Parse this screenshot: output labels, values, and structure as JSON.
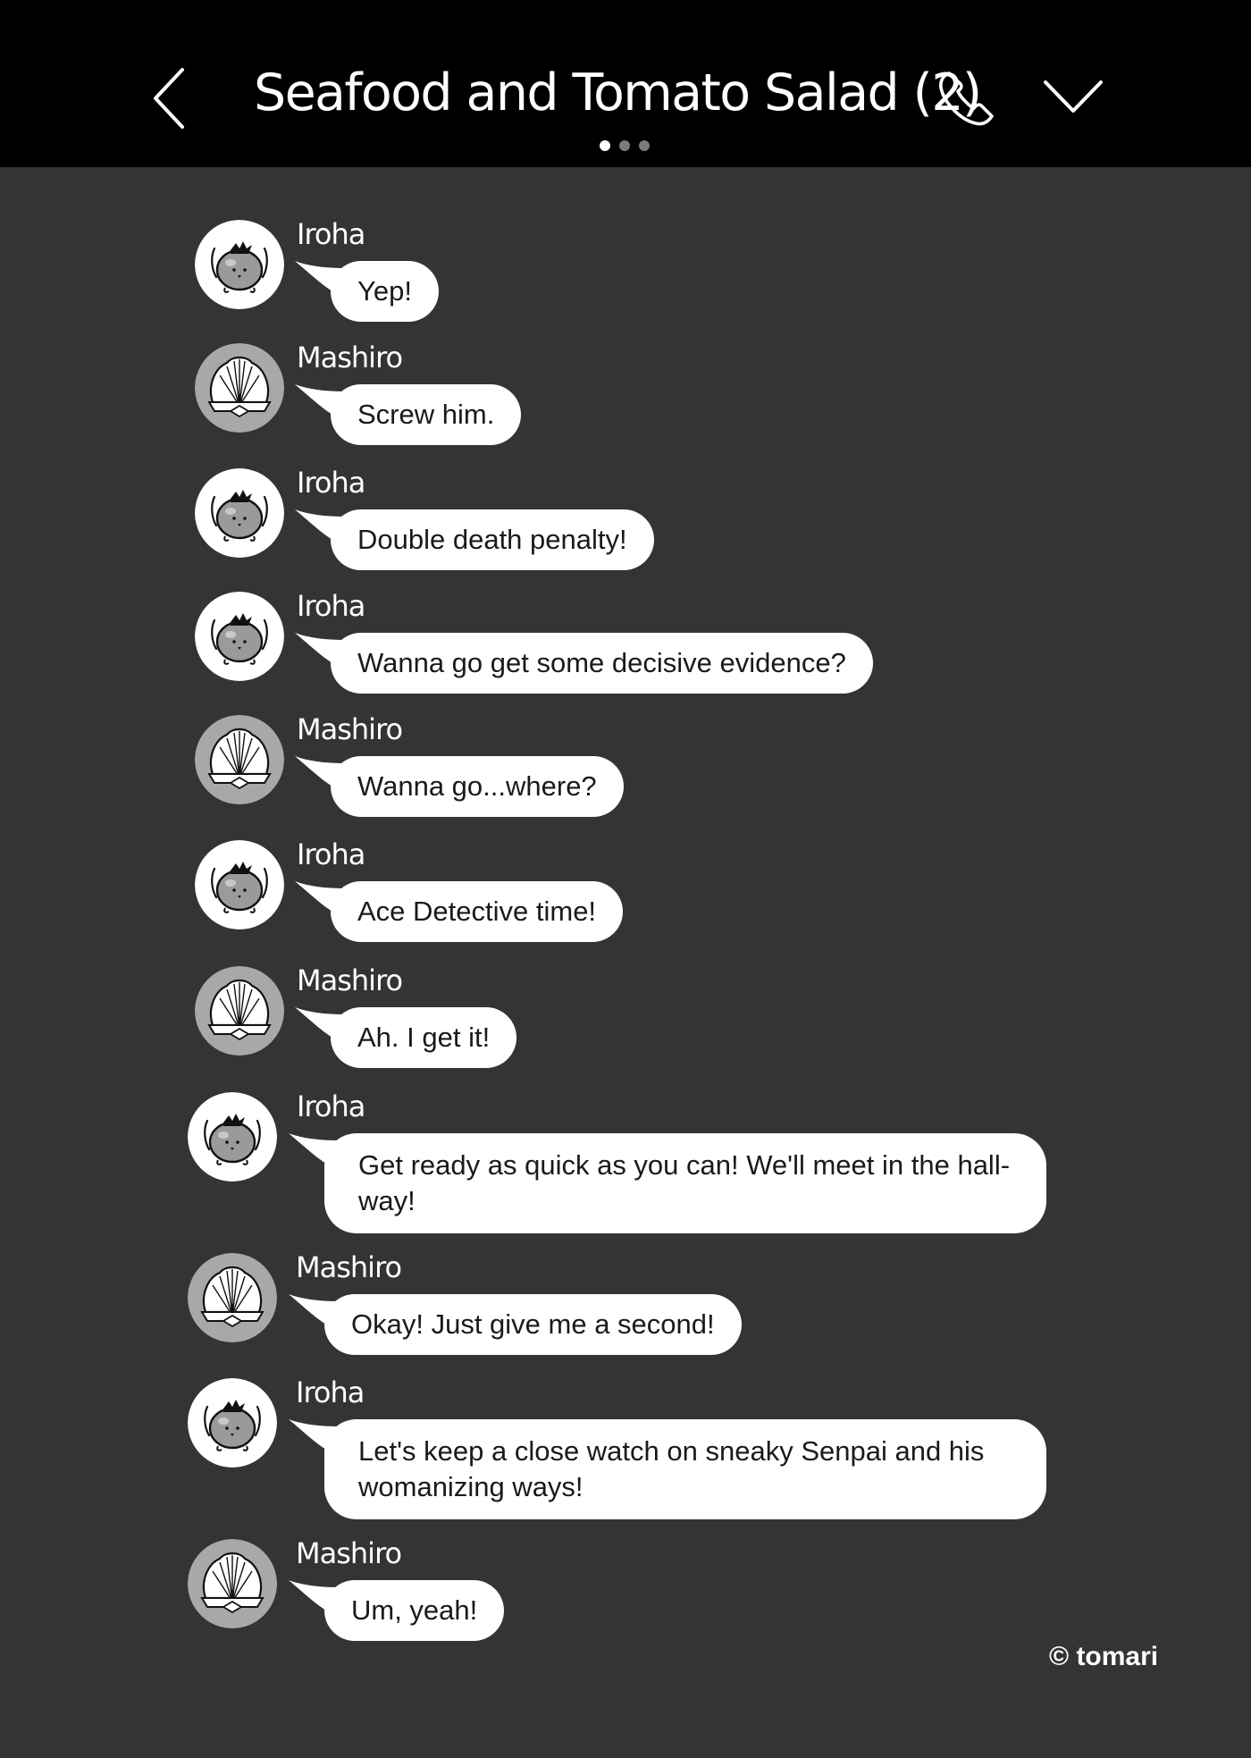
{
  "header": {
    "title": "Seafood and Tomato Salad (2)",
    "back_icon": "chevron-left-icon",
    "call_icon": "phone-icon",
    "menu_icon": "chevron-down-icon",
    "page_dots": 3,
    "active_dot": 0
  },
  "colors": {
    "header_bg": "#000000",
    "chat_bg": "#343434",
    "bubble_bg": "#ffffff",
    "text_light": "#ffffff",
    "text_dark": "#1a1a1a"
  },
  "messages": [
    {
      "sender": "Iroha",
      "avatar": "tomato-avatar-icon",
      "text": "Yep!"
    },
    {
      "sender": "Mashiro",
      "avatar": "shell-avatar-icon",
      "text": "Screw him."
    },
    {
      "sender": "Iroha",
      "avatar": "tomato-avatar-icon",
      "text": "Double death penalty!"
    },
    {
      "sender": "Iroha",
      "avatar": "tomato-avatar-icon",
      "text": "Wanna go get some decisive evidence?"
    },
    {
      "sender": "Mashiro",
      "avatar": "shell-avatar-icon",
      "text": "Wanna go...where?"
    },
    {
      "sender": "Iroha",
      "avatar": "tomato-avatar-icon",
      "text": "Ace Detective time!"
    },
    {
      "sender": "Mashiro",
      "avatar": "shell-avatar-icon",
      "text": "Ah. I get it!"
    },
    {
      "sender": "Iroha",
      "avatar": "tomato-avatar-icon",
      "text": "Get ready as quick as you can! We'll meet in the hall-way!"
    },
    {
      "sender": "Mashiro",
      "avatar": "shell-avatar-icon",
      "text": "Okay! Just give me a second!"
    },
    {
      "sender": "Iroha",
      "avatar": "tomato-avatar-icon",
      "text": "Let's keep a close watch on sneaky Senpai and his womanizing ways!"
    },
    {
      "sender": "Mashiro",
      "avatar": "shell-avatar-icon",
      "text": "Um, yeah!"
    }
  ],
  "footer": {
    "copyright": "© tomari"
  }
}
